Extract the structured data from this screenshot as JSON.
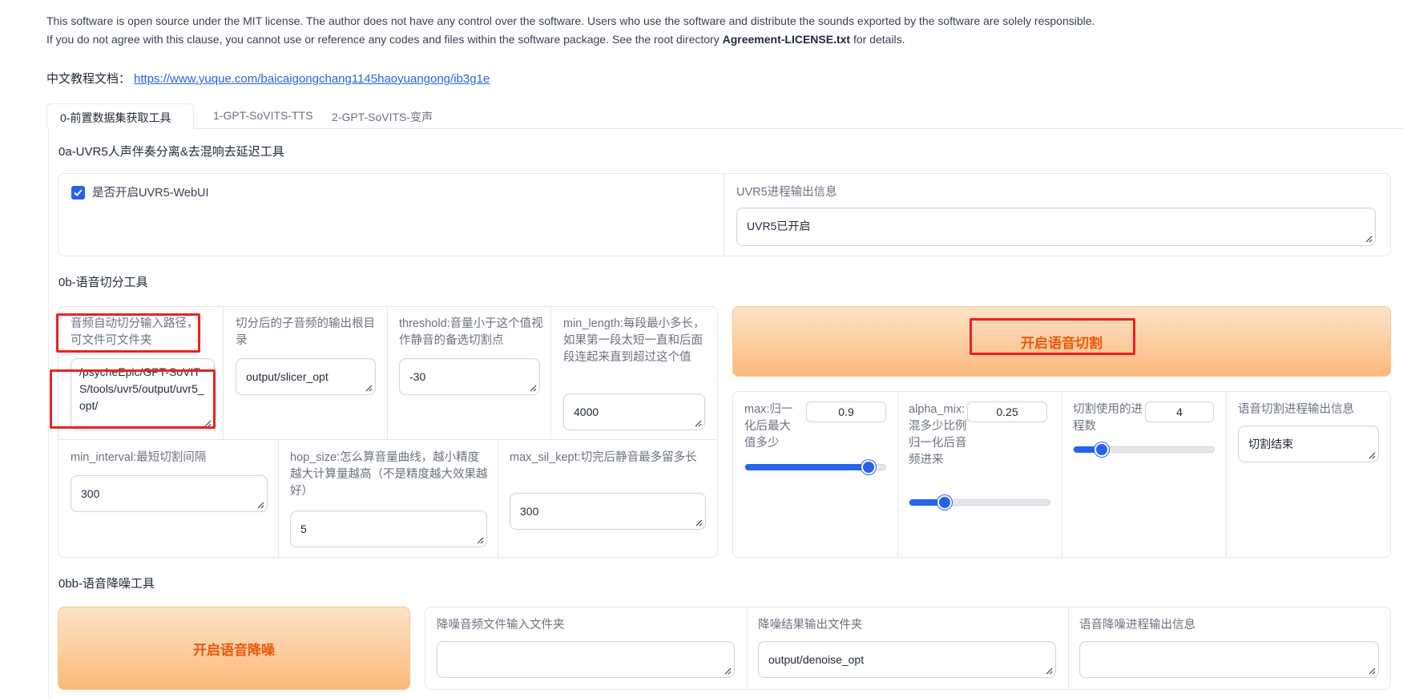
{
  "notice": {
    "line1": "This software is open source under the MIT license. The author does not have any control over the software. Users who use the software and distribute the sounds exported by the software are solely responsible.",
    "line2_prefix": "If you do not agree with this clause, you cannot use or reference any codes and files within the software package. See the root directory ",
    "line2_bold": "Agreement-LICENSE.txt",
    "line2_suffix": " for details."
  },
  "doc": {
    "label": "中文教程文档：",
    "url": "https://www.yuque.com/baicaigongchang1145haoyuangong/ib3g1e"
  },
  "tabs": [
    {
      "label": "0-前置数据集获取工具",
      "active": true
    },
    {
      "label": "1-GPT-SoVITS-TTS",
      "active": false
    },
    {
      "label": "2-GPT-SoVITS-变声",
      "active": false
    }
  ],
  "uvr5": {
    "title": "0a-UVR5人声伴奏分离&去混响去延迟工具",
    "checkbox_label": "是否开启UVR5-WebUI",
    "checked": true,
    "output_label": "UVR5进程输出信息",
    "output_value": "UVR5已开启"
  },
  "slicer": {
    "title": "0b-语音切分工具",
    "input_path_label": "音频自动切分输入路径，可文件可文件夹",
    "input_path_value": "/psycheEpic/GPT-SoVITS/tools/uvr5/output/uvr5_opt/",
    "output_root_label": "切分后的子音频的输出根目录",
    "output_root_value": "output/slicer_opt",
    "threshold_label": "threshold:音量小于这个值视作静音的备选切割点",
    "threshold_value": "-30",
    "min_length_label": "min_length:每段最小多长，如果第一段太短一直和后面段连起来直到超过这个值",
    "min_length_value": "4000",
    "min_interval_label": "min_interval:最短切割间隔",
    "min_interval_value": "300",
    "hop_size_label": "hop_size:怎么算音量曲线，越小精度越大计算量越高（不是精度越大效果越好）",
    "hop_size_value": "5",
    "max_sil_kept_label": "max_sil_kept:切完后静音最多留多长",
    "max_sil_kept_value": "300",
    "start_button": "开启语音切割",
    "max_label": "max:归一化后最大值多少",
    "max_value": "0.9",
    "max_fraction": 0.88,
    "alpha_label": "alpha_mix:混多少比例归一化后音频进来",
    "alpha_value": "0.25",
    "alpha_fraction": 0.25,
    "procs_label": "切割使用的进程数",
    "procs_value": "4",
    "procs_fraction": 0.2,
    "output_label": "语音切割进程输出信息",
    "output_value": "切割结束"
  },
  "denoise": {
    "title": "0bb-语音降噪工具",
    "start_button": "开启语音降噪",
    "input_label": "降噪音频文件输入文件夹",
    "input_value": "",
    "output_dir_label": "降噪结果输出文件夹",
    "output_dir_value": "output/denoise_opt",
    "log_label": "语音降噪进程输出信息",
    "log_value": ""
  },
  "colors": {
    "accent": "#2563eb",
    "button_text": "#ea580c",
    "highlight": "#ef2020"
  }
}
